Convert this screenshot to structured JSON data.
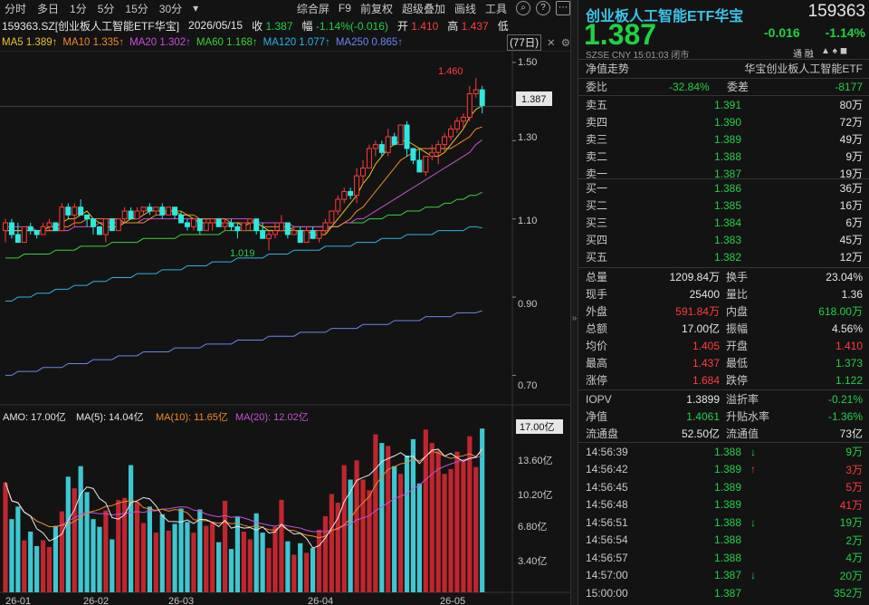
{
  "toolbar": {
    "tabs": [
      "分时",
      "多日",
      "1分",
      "5分",
      "15分",
      "30分"
    ],
    "dropdown": "▾",
    "buttons": [
      "综合屏",
      "F9",
      "前复权",
      "超级叠加",
      "画线",
      "工具"
    ]
  },
  "quote_line": {
    "code_name": "159363.SZ[创业板人工智能ETF华宝]",
    "date": "2026/05/15",
    "close_label": "收",
    "close": "1.387",
    "change_label": "幅",
    "change": "-1.14%(-0.016)",
    "open_label": "开",
    "open": "1.410",
    "high_label": "高",
    "high": "1.437",
    "low_label": "低"
  },
  "ma_line": {
    "ma5": "MA5 1.389↑",
    "ma10": "MA10 1.335↑",
    "ma20": "MA20 1.302↑",
    "ma60": "MA60 1.168↑",
    "ma120": "MA120 1.077↑",
    "ma250": "MA250 0.865↑",
    "period": "(77日)"
  },
  "price_axis": {
    "labels": [
      "1.50",
      "1.30",
      "1.10",
      "0.90",
      "0.70"
    ],
    "current": "1.387",
    "high_mark": "1.460",
    "low_mark": "1.019"
  },
  "vol_line": {
    "amo": "AMO: 17.00亿",
    "ma5": "MA(5): 14.04亿",
    "ma10": "MA(10): 11.65亿",
    "ma20": "MA(20): 12.02亿"
  },
  "vol_axis": {
    "labels": [
      "13.60亿",
      "10.20亿",
      "6.80亿",
      "3.40亿"
    ],
    "current": "17.00亿"
  },
  "date_axis": [
    "26-01",
    "26-02",
    "26-03",
    "26-04",
    "26-05"
  ],
  "header": {
    "name": "创业板人工智能ETF华宝",
    "code": "159363",
    "price": "1.387",
    "change": "-0.016",
    "pct": "-1.14%",
    "meta": "SZSE  CNY  15:01:03  闭市",
    "icons": "通  融"
  },
  "nav_row": {
    "label": "净值走势",
    "value": "华宝创业板人工智能ETF"
  },
  "ratio_row": {
    "label1": "委比",
    "value1": "-32.84%",
    "label2": "委差",
    "value2": "-8177"
  },
  "sell": [
    {
      "label": "卖五",
      "price": "1.391",
      "vol": "80万"
    },
    {
      "label": "卖四",
      "price": "1.390",
      "vol": "72万"
    },
    {
      "label": "卖三",
      "price": "1.389",
      "vol": "49万"
    },
    {
      "label": "卖二",
      "price": "1.388",
      "vol": "9万"
    },
    {
      "label": "卖一",
      "price": "1.387",
      "vol": "19万"
    }
  ],
  "buy": [
    {
      "label": "买一",
      "price": "1.386",
      "vol": "36万"
    },
    {
      "label": "买二",
      "price": "1.385",
      "vol": "16万"
    },
    {
      "label": "买三",
      "price": "1.384",
      "vol": "6万"
    },
    {
      "label": "买四",
      "price": "1.383",
      "vol": "45万"
    },
    {
      "label": "买五",
      "price": "1.382",
      "vol": "12万"
    }
  ],
  "stats": [
    {
      "l1": "总量",
      "v1": "1209.84万",
      "l2": "换手",
      "v2": "23.04%",
      "c1": "white",
      "c2": "white"
    },
    {
      "l1": "现手",
      "v1": "25400",
      "l2": "量比",
      "v2": "1.36",
      "c1": "white",
      "c2": "white"
    },
    {
      "l1": "外盘",
      "v1": "591.84万",
      "l2": "内盘",
      "v2": "618.00万",
      "c1": "red",
      "c2": "green"
    },
    {
      "l1": "总额",
      "v1": "17.00亿",
      "l2": "振幅",
      "v2": "4.56%",
      "c1": "white",
      "c2": "white"
    },
    {
      "l1": "均价",
      "v1": "1.405",
      "l2": "开盘",
      "v2": "1.410",
      "c1": "red",
      "c2": "red"
    },
    {
      "l1": "最高",
      "v1": "1.437",
      "l2": "最低",
      "v2": "1.373",
      "c1": "red",
      "c2": "green"
    },
    {
      "l1": "涨停",
      "v1": "1.684",
      "l2": "跌停",
      "v2": "1.122",
      "c1": "red",
      "c2": "green"
    }
  ],
  "stats2": [
    {
      "l1": "IOPV",
      "v1": "1.3899",
      "l2": "溢折率",
      "v2": "-0.21%",
      "c1": "white",
      "c2": "green"
    },
    {
      "l1": "净值",
      "v1": "1.4061",
      "l2": "升贴水率",
      "v2": "-1.36%",
      "c1": "green",
      "c2": "green"
    },
    {
      "l1": "流通盘",
      "v1": "52.50亿",
      "l2": "流通值",
      "v2": "73亿",
      "c1": "white",
      "c2": "white"
    }
  ],
  "ticks": [
    {
      "time": "14:56:39",
      "price": "1.388",
      "arrow": "↓",
      "vol": "9万",
      "ac": "green",
      "vc": "green"
    },
    {
      "time": "14:56:42",
      "price": "1.389",
      "arrow": "↑",
      "vol": "3万",
      "ac": "red",
      "vc": "red"
    },
    {
      "time": "14:56:45",
      "price": "1.389",
      "arrow": "",
      "vol": "5万",
      "ac": "red",
      "vc": "red"
    },
    {
      "time": "14:56:48",
      "price": "1.389",
      "arrow": "",
      "vol": "41万",
      "ac": "red",
      "vc": "red"
    },
    {
      "time": "14:56:51",
      "price": "1.388",
      "arrow": "↓",
      "vol": "19万",
      "ac": "green",
      "vc": "green"
    },
    {
      "time": "14:56:54",
      "price": "1.388",
      "arrow": "",
      "vol": "2万",
      "ac": "green",
      "vc": "green"
    },
    {
      "time": "14:56:57",
      "price": "1.388",
      "arrow": "",
      "vol": "4万",
      "ac": "green",
      "vc": "green"
    },
    {
      "time": "14:57:00",
      "price": "1.387",
      "arrow": "↓",
      "vol": "20万",
      "ac": "green",
      "vc": "green"
    },
    {
      "time": "15:00:00",
      "price": "1.387",
      "arrow": "",
      "vol": "352万",
      "ac": "green",
      "vc": "green"
    }
  ],
  "chart_data": {
    "type": "candlestick",
    "y_axis_ticks": [
      1.5,
      1.3,
      1.1,
      0.9,
      0.7
    ],
    "candles": [
      [
        1.07,
        1.1,
        1.04,
        1.09
      ],
      [
        1.09,
        1.1,
        1.05,
        1.06
      ],
      [
        1.06,
        1.09,
        1.04,
        1.04
      ],
      [
        1.04,
        1.08,
        1.04,
        1.08
      ],
      [
        1.08,
        1.09,
        1.06,
        1.07
      ],
      [
        1.07,
        1.07,
        1.05,
        1.06
      ],
      [
        1.06,
        1.09,
        1.06,
        1.08
      ],
      [
        1.08,
        1.1,
        1.07,
        1.09
      ],
      [
        1.09,
        1.09,
        1.07,
        1.07
      ],
      [
        1.07,
        1.14,
        1.07,
        1.13
      ],
      [
        1.13,
        1.14,
        1.1,
        1.11
      ],
      [
        1.11,
        1.14,
        1.08,
        1.13
      ],
      [
        1.13,
        1.15,
        1.11,
        1.11
      ],
      [
        1.11,
        1.11,
        1.08,
        1.1
      ],
      [
        1.1,
        1.1,
        1.06,
        1.08
      ],
      [
        1.08,
        1.08,
        1.06,
        1.06
      ],
      [
        1.06,
        1.1,
        1.04,
        1.1
      ],
      [
        1.1,
        1.1,
        1.07,
        1.07
      ],
      [
        1.07,
        1.1,
        1.07,
        1.1
      ],
      [
        1.1,
        1.13,
        1.09,
        1.12
      ],
      [
        1.12,
        1.13,
        1.1,
        1.1
      ],
      [
        1.1,
        1.13,
        1.1,
        1.12
      ],
      [
        1.12,
        1.13,
        1.11,
        1.13
      ],
      [
        1.13,
        1.14,
        1.11,
        1.12
      ],
      [
        1.12,
        1.13,
        1.11,
        1.13
      ],
      [
        1.13,
        1.14,
        1.1,
        1.11
      ],
      [
        1.11,
        1.13,
        1.11,
        1.13
      ],
      [
        1.13,
        1.13,
        1.1,
        1.11
      ],
      [
        1.11,
        1.12,
        1.09,
        1.09
      ],
      [
        1.09,
        1.1,
        1.07,
        1.08
      ],
      [
        1.08,
        1.1,
        1.07,
        1.1
      ],
      [
        1.1,
        1.1,
        1.06,
        1.07
      ],
      [
        1.07,
        1.1,
        1.07,
        1.09
      ],
      [
        1.09,
        1.1,
        1.07,
        1.1
      ],
      [
        1.1,
        1.1,
        1.08,
        1.08
      ],
      [
        1.08,
        1.1,
        1.07,
        1.09
      ],
      [
        1.09,
        1.1,
        1.07,
        1.08
      ],
      [
        1.08,
        1.09,
        1.05,
        1.07
      ],
      [
        1.07,
        1.09,
        1.07,
        1.09
      ],
      [
        1.09,
        1.1,
        1.07,
        1.1
      ],
      [
        1.1,
        1.1,
        1.06,
        1.07
      ],
      [
        1.07,
        1.09,
        1.05,
        1.05
      ],
      [
        1.05,
        1.07,
        1.02,
        1.06
      ],
      [
        1.06,
        1.09,
        1.05,
        1.07
      ],
      [
        1.07,
        1.11,
        1.07,
        1.09
      ],
      [
        1.09,
        1.09,
        1.05,
        1.06
      ],
      [
        1.06,
        1.08,
        1.06,
        1.07
      ],
      [
        1.07,
        1.08,
        1.04,
        1.04
      ],
      [
        1.04,
        1.08,
        1.04,
        1.07
      ],
      [
        1.07,
        1.08,
        1.05,
        1.05
      ],
      [
        1.05,
        1.07,
        1.04,
        1.07
      ],
      [
        1.07,
        1.1,
        1.06,
        1.09
      ],
      [
        1.09,
        1.12,
        1.09,
        1.12
      ],
      [
        1.12,
        1.16,
        1.11,
        1.15
      ],
      [
        1.15,
        1.18,
        1.14,
        1.17
      ],
      [
        1.17,
        1.18,
        1.15,
        1.16
      ],
      [
        1.16,
        1.23,
        1.14,
        1.21
      ],
      [
        1.21,
        1.25,
        1.19,
        1.23
      ],
      [
        1.23,
        1.29,
        1.23,
        1.28
      ],
      [
        1.28,
        1.3,
        1.26,
        1.29
      ],
      [
        1.29,
        1.3,
        1.26,
        1.27
      ],
      [
        1.27,
        1.33,
        1.26,
        1.31
      ],
      [
        1.31,
        1.32,
        1.29,
        1.29
      ],
      [
        1.29,
        1.34,
        1.29,
        1.34
      ],
      [
        1.34,
        1.35,
        1.26,
        1.28
      ],
      [
        1.28,
        1.28,
        1.24,
        1.25
      ],
      [
        1.25,
        1.28,
        1.22,
        1.22
      ],
      [
        1.22,
        1.26,
        1.21,
        1.26
      ],
      [
        1.26,
        1.29,
        1.25,
        1.27
      ],
      [
        1.27,
        1.3,
        1.24,
        1.29
      ],
      [
        1.29,
        1.32,
        1.27,
        1.31
      ],
      [
        1.31,
        1.34,
        1.3,
        1.33
      ],
      [
        1.33,
        1.36,
        1.32,
        1.35
      ],
      [
        1.35,
        1.37,
        1.33,
        1.36
      ],
      [
        1.36,
        1.44,
        1.35,
        1.42
      ],
      [
        1.42,
        1.46,
        1.41,
        1.43
      ],
      [
        1.43,
        1.44,
        1.37,
        1.39
      ]
    ],
    "volume_axis_ticks": [
      13.6,
      10.2,
      6.8,
      3.4
    ],
    "volumes": [
      11.4,
      7.6,
      8.9,
      5.4,
      6.3,
      4.8,
      5.4,
      4.7,
      6.9,
      8.4,
      12.0,
      10.8,
      13.1,
      10.4,
      7.6,
      6.8,
      8.5,
      5.5,
      9.6,
      9.8,
      13.2,
      9.4,
      7.2,
      8.9,
      6.2,
      8.1,
      6.4,
      7.1,
      8.7,
      7.3,
      6.2,
      8.6,
      6.9,
      7.2,
      5.2,
      9.5,
      4.5,
      7.8,
      6.3,
      5.5,
      8.2,
      6.2,
      4.6,
      6.8,
      9.6,
      5.3,
      3.9,
      5.1,
      4.1,
      4.6,
      6.5,
      7.9,
      10.2,
      9.3,
      13.2,
      11.7,
      13.7,
      11.7,
      10.6,
      16.4,
      15.5,
      15.2,
      13.1,
      12.3,
      14.2,
      15.9,
      11.3,
      16.9,
      15.5,
      14.7,
      12.3,
      12.8,
      14.6,
      13.6,
      16.2,
      13.0,
      17.0
    ],
    "ma5": [
      1.07,
      1.07,
      1.07,
      1.07,
      1.07,
      1.07,
      1.07,
      1.08,
      1.08,
      1.09,
      1.1,
      1.1,
      1.11,
      1.12,
      1.1,
      1.09,
      1.08,
      1.08,
      1.08,
      1.09,
      1.1,
      1.1,
      1.11,
      1.12,
      1.12,
      1.12,
      1.12,
      1.12,
      1.11,
      1.11,
      1.1,
      1.09,
      1.09,
      1.09,
      1.09,
      1.09,
      1.09,
      1.09,
      1.08,
      1.09,
      1.09,
      1.08,
      1.07,
      1.07,
      1.07,
      1.07,
      1.07,
      1.07,
      1.07,
      1.06,
      1.06,
      1.06,
      1.08,
      1.1,
      1.12,
      1.14,
      1.16,
      1.19,
      1.21,
      1.24,
      1.26,
      1.28,
      1.29,
      1.3,
      1.3,
      1.29,
      1.28,
      1.27,
      1.26,
      1.26,
      1.27,
      1.29,
      1.31,
      1.33,
      1.36,
      1.38,
      1.389
    ],
    "ma10": [
      1.07,
      1.07,
      1.07,
      1.07,
      1.07,
      1.07,
      1.07,
      1.07,
      1.07,
      1.08,
      1.08,
      1.09,
      1.09,
      1.1,
      1.1,
      1.1,
      1.1,
      1.1,
      1.1,
      1.09,
      1.09,
      1.09,
      1.09,
      1.1,
      1.11,
      1.11,
      1.12,
      1.12,
      1.12,
      1.11,
      1.11,
      1.1,
      1.1,
      1.1,
      1.1,
      1.1,
      1.09,
      1.09,
      1.09,
      1.09,
      1.09,
      1.08,
      1.08,
      1.08,
      1.08,
      1.08,
      1.07,
      1.07,
      1.07,
      1.07,
      1.07,
      1.07,
      1.08,
      1.08,
      1.09,
      1.1,
      1.12,
      1.13,
      1.15,
      1.17,
      1.19,
      1.21,
      1.23,
      1.25,
      1.26,
      1.27,
      1.28,
      1.28,
      1.28,
      1.28,
      1.28,
      1.28,
      1.29,
      1.3,
      1.31,
      1.33,
      1.335
    ],
    "ma20": [
      1.08,
      1.08,
      1.08,
      1.08,
      1.08,
      1.07,
      1.07,
      1.07,
      1.07,
      1.07,
      1.07,
      1.08,
      1.08,
      1.08,
      1.08,
      1.09,
      1.09,
      1.09,
      1.09,
      1.09,
      1.09,
      1.09,
      1.1,
      1.1,
      1.1,
      1.1,
      1.1,
      1.1,
      1.1,
      1.1,
      1.1,
      1.1,
      1.1,
      1.1,
      1.1,
      1.1,
      1.1,
      1.1,
      1.1,
      1.1,
      1.09,
      1.09,
      1.09,
      1.09,
      1.09,
      1.09,
      1.08,
      1.08,
      1.08,
      1.08,
      1.08,
      1.08,
      1.08,
      1.08,
      1.09,
      1.09,
      1.1,
      1.1,
      1.11,
      1.12,
      1.13,
      1.14,
      1.15,
      1.16,
      1.17,
      1.18,
      1.19,
      1.2,
      1.21,
      1.22,
      1.23,
      1.24,
      1.25,
      1.26,
      1.27,
      1.29,
      1.302
    ],
    "ma60": [
      1.0,
      1.0,
      1.0,
      1.01,
      1.01,
      1.01,
      1.01,
      1.01,
      1.02,
      1.02,
      1.02,
      1.02,
      1.03,
      1.03,
      1.03,
      1.03,
      1.03,
      1.04,
      1.04,
      1.04,
      1.04,
      1.04,
      1.05,
      1.05,
      1.05,
      1.05,
      1.05,
      1.05,
      1.06,
      1.06,
      1.06,
      1.06,
      1.06,
      1.06,
      1.06,
      1.07,
      1.07,
      1.07,
      1.07,
      1.07,
      1.07,
      1.07,
      1.07,
      1.07,
      1.07,
      1.07,
      1.08,
      1.08,
      1.08,
      1.08,
      1.08,
      1.08,
      1.08,
      1.08,
      1.09,
      1.09,
      1.09,
      1.09,
      1.1,
      1.1,
      1.1,
      1.11,
      1.11,
      1.11,
      1.12,
      1.12,
      1.12,
      1.13,
      1.13,
      1.13,
      1.14,
      1.14,
      1.15,
      1.15,
      1.16,
      1.16,
      1.168
    ],
    "ma120": [
      0.89,
      0.89,
      0.9,
      0.9,
      0.9,
      0.91,
      0.91,
      0.91,
      0.92,
      0.92,
      0.92,
      0.93,
      0.93,
      0.93,
      0.94,
      0.94,
      0.94,
      0.95,
      0.95,
      0.95,
      0.95,
      0.96,
      0.96,
      0.96,
      0.96,
      0.97,
      0.97,
      0.97,
      0.97,
      0.98,
      0.98,
      0.98,
      0.98,
      0.99,
      0.99,
      0.99,
      0.99,
      1.0,
      1.0,
      1.0,
      1.0,
      1.0,
      1.01,
      1.01,
      1.01,
      1.01,
      1.02,
      1.02,
      1.02,
      1.02,
      1.02,
      1.03,
      1.03,
      1.03,
      1.03,
      1.03,
      1.04,
      1.04,
      1.04,
      1.04,
      1.05,
      1.05,
      1.05,
      1.05,
      1.06,
      1.06,
      1.06,
      1.06,
      1.06,
      1.07,
      1.07,
      1.07,
      1.07,
      1.07,
      1.08,
      1.08,
      1.077
    ],
    "ma250": [
      0.7,
      0.7,
      0.71,
      0.71,
      0.71,
      0.71,
      0.72,
      0.72,
      0.72,
      0.72,
      0.73,
      0.73,
      0.73,
      0.73,
      0.74,
      0.74,
      0.74,
      0.74,
      0.75,
      0.75,
      0.75,
      0.75,
      0.76,
      0.76,
      0.76,
      0.76,
      0.76,
      0.77,
      0.77,
      0.77,
      0.77,
      0.77,
      0.78,
      0.78,
      0.78,
      0.78,
      0.78,
      0.79,
      0.79,
      0.79,
      0.79,
      0.79,
      0.8,
      0.8,
      0.8,
      0.8,
      0.8,
      0.81,
      0.81,
      0.81,
      0.81,
      0.81,
      0.82,
      0.82,
      0.82,
      0.82,
      0.82,
      0.83,
      0.83,
      0.83,
      0.83,
      0.83,
      0.84,
      0.84,
      0.84,
      0.84,
      0.84,
      0.85,
      0.85,
      0.85,
      0.85,
      0.85,
      0.86,
      0.86,
      0.86,
      0.86,
      0.865
    ]
  }
}
